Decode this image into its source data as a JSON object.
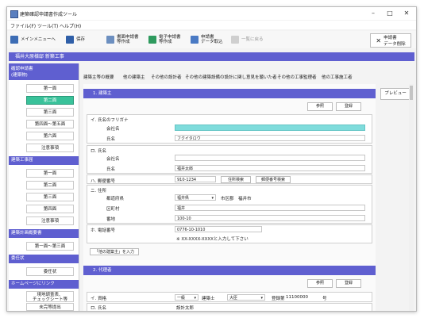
{
  "window": {
    "title": "建築確認申請書作成ツール"
  },
  "menu": [
    "ファイル(F)",
    "ツール(T)",
    "ヘルプ(H)"
  ],
  "toolbar": {
    "main_menu": "メインメニューへ",
    "save": "保存",
    "paper_doc_l1": "書面申請書",
    "paper_doc_l2": "等作成",
    "electronic_doc_l1": "電子申請書",
    "electronic_doc_l2": "等作成",
    "data_import_l1": "申請書",
    "data_import_l2": "データ取込",
    "back_to_list": "一覧に戻る",
    "apply_data_l1": "申請書",
    "apply_data_l2": "データ削除"
  },
  "pathbar": "福井大原様邸 新築工事",
  "sidebar": {
    "head1_l1": "確認申請書",
    "head1_l2": "(建築物)",
    "items1": [
      "第一面",
      "第二面",
      "第三面",
      "第四面〜第五面",
      "第六面",
      "注意事項"
    ],
    "head2": "建築工事届",
    "items2": [
      "第一面",
      "第二面",
      "第三面",
      "第四面",
      "注意事項"
    ],
    "head3": "建築計画概要書",
    "items3": [
      "第一面〜第三面"
    ],
    "head4": "委任状",
    "items4": [
      "委任状"
    ],
    "head5": "ホームページにリンク",
    "items5_l1": "現地調査表、",
    "items5_l2": "チェックシート等",
    "items5b": "未完等提出"
  },
  "tabs": [
    "建築主等の概要",
    "他の建築主",
    "その他の設計者",
    "その他の建築設備の設計に関し意見を聴いた者",
    "その他の工事監理者",
    "他の工事施工者"
  ],
  "preview": "プレビュー",
  "section1": {
    "title": "1. 建築主",
    "ref": "参照",
    "register": "登録",
    "i_title": "イ. 氏名のフリガナ",
    "company_label": "会社名",
    "company_value": "",
    "name_label": "氏名",
    "name_kana": "フクイタロウ",
    "ro_title": "ロ. 氏名",
    "company2_label": "会社名",
    "company2_value": "",
    "name2_label": "氏名",
    "name2_value": "福井太郎",
    "ha_title": "ハ. 郵便番号",
    "postal": "910-1234",
    "address_search": "住所検索",
    "postal_search": "郵便番号検索",
    "ni_title": "ニ. 住所",
    "pref_label": "都道府県",
    "pref_value": "福井県",
    "city_label": "市区郡",
    "city_value": "福井市",
    "town_label": "区町村",
    "town_value": "福井",
    "banchi_label": "番地",
    "banchi_value": "100-10",
    "ho_title": "ホ. 電話番号",
    "phone": "0776-10-1010",
    "phone_hint": "※ XX-XXXX-XXXXと入力して下さい",
    "other_owner_btn": "「他の建築主」を入力"
  },
  "section2": {
    "title": "2. 代理者",
    "ref": "参照",
    "register": "登録",
    "i_title": "イ. 資格",
    "grade": "一級",
    "kenchikushi": "建築士",
    "minister": "大臣",
    "reg_label": "登録第",
    "reg_no": "11100000",
    "go": "号",
    "ro_title": "ロ. 氏名",
    "name_value": "設計太郎"
  }
}
